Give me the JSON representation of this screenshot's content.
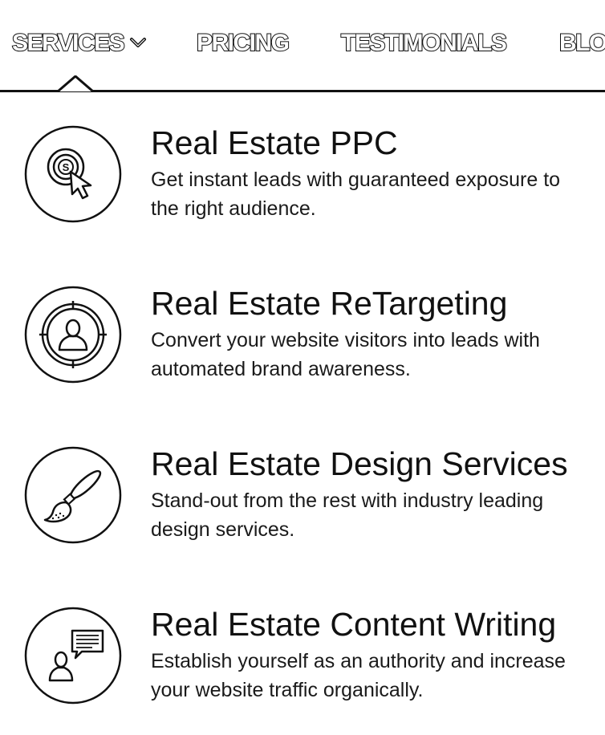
{
  "nav": {
    "items": [
      {
        "label": "SERVICES"
      },
      {
        "label": "PRICING"
      },
      {
        "label": "TESTIMONIALS"
      },
      {
        "label": "BLO"
      }
    ],
    "dropdown_icon": "chevron-down-icon"
  },
  "services": [
    {
      "title": "Real Estate PPC",
      "description": "Get instant leads with guaranteed exposure to the right audience.",
      "icon": "target-cursor-icon"
    },
    {
      "title": "Real Estate ReTargeting",
      "description": "Convert your website visitors into leads with automated brand awareness.",
      "icon": "user-target-icon"
    },
    {
      "title": "Real Estate Design Services",
      "description": "Stand-out from the rest with industry leading design services.",
      "icon": "paintbrush-icon"
    },
    {
      "title": "Real Estate Content Writing",
      "description": "Establish yourself as an authority and increase your website traffic organically.",
      "icon": "user-chat-icon"
    }
  ]
}
